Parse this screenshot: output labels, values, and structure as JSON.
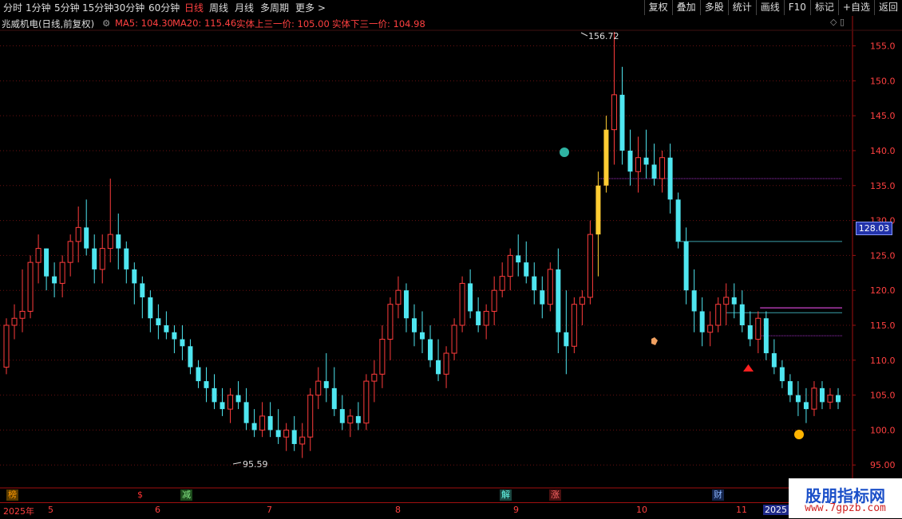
{
  "toolbar": {
    "periods": [
      "分时",
      "1分钟",
      "5分钟",
      "15分钟",
      "30分钟",
      "60分钟",
      "日线",
      "周线",
      "月线",
      "多周期",
      "更多 >"
    ],
    "active_period": "日线",
    "buttons": [
      "复权",
      "叠加",
      "多股",
      "统计",
      "画线",
      "F10",
      "标记",
      "+自选",
      "返回"
    ]
  },
  "info": {
    "title": "兆威机电(日线,前复权)",
    "ma5": "MA5: 104.30",
    "ma20": "MA20: 115.46",
    "upper": "实体上三一价: 105.00",
    "lower": "实体下三一价: 104.98",
    "icons": "◇ ▯"
  },
  "price_axis": {
    "ticks": [
      "155.0",
      "150.0",
      "145.0",
      "140.0",
      "135.0",
      "130.0",
      "125.0",
      "120.0",
      "115.0",
      "110.0",
      "105.0",
      "100.0",
      "95.00"
    ],
    "current_price": "128.03"
  },
  "annotations": {
    "high": "156.72",
    "low": "95.59"
  },
  "events": [
    "榜",
    "$",
    "减",
    "解",
    "涨",
    "财"
  ],
  "time_axis": {
    "year_start": "2025年",
    "months": [
      "5",
      "6",
      "7",
      "8",
      "9",
      "10",
      "11"
    ],
    "year_end": "2025"
  },
  "watermark": {
    "line1": "股朋指标网",
    "line2": "www.7gpzb.com"
  },
  "colors": {
    "up": "#ff3c3c",
    "down": "#4fe6f0",
    "highlight": "#ffcc33",
    "magenta": "#ff55ff",
    "background": "#000000",
    "axis": "#a01010"
  },
  "chart_data": {
    "type": "candlestick",
    "ylim": [
      94,
      157
    ],
    "candles": [
      [
        109,
        116,
        108,
        115
      ],
      [
        115,
        118,
        113,
        116
      ],
      [
        116,
        123,
        114,
        117
      ],
      [
        117,
        125,
        116,
        124
      ],
      [
        124,
        128,
        121,
        126
      ],
      [
        126,
        126,
        120,
        122
      ],
      [
        122,
        124,
        119,
        121
      ],
      [
        121,
        125,
        119,
        124
      ],
      [
        124,
        128,
        122,
        127
      ],
      [
        127,
        132,
        124,
        129
      ],
      [
        129,
        133,
        125,
        126
      ],
      [
        126,
        128,
        121,
        123
      ],
      [
        123,
        128,
        121,
        126
      ],
      [
        126,
        136,
        124,
        128
      ],
      [
        128,
        131,
        123,
        126
      ],
      [
        126,
        127,
        121,
        123
      ],
      [
        123,
        124,
        118,
        121
      ],
      [
        121,
        122,
        116,
        119
      ],
      [
        119,
        120,
        114,
        116
      ],
      [
        116,
        118,
        113,
        115
      ],
      [
        115,
        117,
        113,
        114
      ],
      [
        114,
        115,
        111,
        113
      ],
      [
        113,
        115,
        110,
        112
      ],
      [
        112,
        113,
        108,
        109
      ],
      [
        109,
        110,
        106,
        107
      ],
      [
        107,
        109,
        104,
        106
      ],
      [
        106,
        108,
        103,
        104
      ],
      [
        104,
        106,
        102,
        103
      ],
      [
        103,
        106,
        101,
        105
      ],
      [
        105,
        107,
        103,
        104
      ],
      [
        104,
        106,
        100,
        101
      ],
      [
        101,
        103,
        99,
        100
      ],
      [
        100,
        104,
        99,
        102
      ],
      [
        102,
        104,
        99,
        100
      ],
      [
        100,
        103,
        98,
        99
      ],
      [
        99,
        101,
        97,
        100
      ],
      [
        100,
        102,
        97,
        98
      ],
      [
        98,
        101,
        96,
        99
      ],
      [
        99,
        106,
        97,
        105
      ],
      [
        105,
        109,
        103,
        107
      ],
      [
        107,
        111,
        104,
        106
      ],
      [
        106,
        109,
        102,
        103
      ],
      [
        103,
        105,
        100,
        101
      ],
      [
        101,
        103,
        99,
        102
      ],
      [
        102,
        104,
        100,
        101
      ],
      [
        101,
        108,
        100,
        107
      ],
      [
        107,
        110,
        104,
        108
      ],
      [
        108,
        115,
        106,
        113
      ],
      [
        113,
        119,
        110,
        118
      ],
      [
        118,
        122,
        116,
        120
      ],
      [
        120,
        121,
        114,
        116
      ],
      [
        116,
        118,
        112,
        114
      ],
      [
        114,
        117,
        111,
        113
      ],
      [
        113,
        115,
        109,
        110
      ],
      [
        110,
        113,
        107,
        108
      ],
      [
        108,
        112,
        106,
        111
      ],
      [
        111,
        116,
        110,
        115
      ],
      [
        115,
        122,
        114,
        121
      ],
      [
        121,
        123,
        116,
        117
      ],
      [
        117,
        119,
        114,
        115
      ],
      [
        115,
        118,
        113,
        117
      ],
      [
        117,
        122,
        115,
        120
      ],
      [
        120,
        124,
        119,
        122
      ],
      [
        122,
        126,
        120,
        125
      ],
      [
        125,
        128,
        122,
        124
      ],
      [
        124,
        127,
        121,
        122
      ],
      [
        122,
        124,
        118,
        120
      ],
      [
        120,
        122,
        116,
        118
      ],
      [
        118,
        124,
        117,
        123
      ],
      [
        123,
        126,
        111,
        114
      ],
      [
        114,
        120,
        108,
        112
      ],
      [
        112,
        119,
        111,
        118
      ],
      [
        118,
        120,
        115,
        119
      ],
      [
        119,
        130,
        118,
        128
      ],
      [
        128,
        137,
        122,
        135
      ],
      [
        135,
        145,
        134,
        143
      ],
      [
        143,
        157,
        138,
        148
      ],
      [
        148,
        152,
        138,
        140
      ],
      [
        140,
        143,
        135,
        137
      ],
      [
        137,
        142,
        134,
        139
      ],
      [
        139,
        143,
        136,
        138
      ],
      [
        138,
        141,
        135,
        136
      ],
      [
        136,
        140,
        134,
        139
      ],
      [
        139,
        141,
        131,
        133
      ],
      [
        133,
        134,
        126,
        127
      ],
      [
        127,
        129,
        118,
        120
      ],
      [
        120,
        123,
        114,
        117
      ],
      [
        117,
        119,
        112,
        114
      ],
      [
        114,
        117,
        112,
        115
      ],
      [
        115,
        119,
        114,
        118
      ],
      [
        118,
        121,
        115,
        119
      ],
      [
        119,
        121,
        116,
        118
      ],
      [
        118,
        120,
        114,
        115
      ],
      [
        115,
        117,
        112,
        113
      ],
      [
        113,
        117,
        111,
        116
      ],
      [
        116,
        117,
        110,
        111
      ],
      [
        111,
        113,
        108,
        109
      ],
      [
        109,
        110,
        106,
        107
      ],
      [
        107,
        108,
        104,
        105
      ],
      [
        105,
        107,
        102,
        104
      ],
      [
        104,
        106,
        101,
        103
      ],
      [
        103,
        107,
        102,
        106
      ],
      [
        106,
        107,
        103,
        104
      ],
      [
        104,
        106,
        103,
        105
      ],
      [
        105,
        106,
        103,
        104
      ]
    ]
  }
}
